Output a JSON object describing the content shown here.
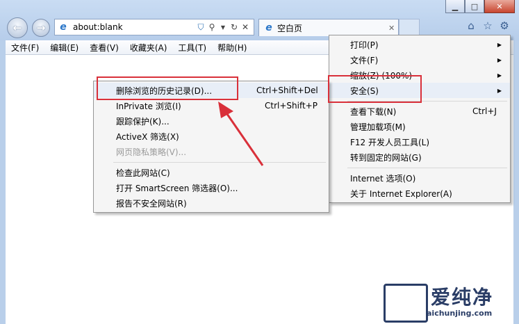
{
  "window": {
    "minimize_glyph": "▁",
    "maximize_glyph": "□",
    "close_glyph": "✕"
  },
  "address_bar": {
    "url": "about:blank"
  },
  "tab": {
    "title": "空白页",
    "close_glyph": "✕"
  },
  "menubar": {
    "items": [
      "文件(F)",
      "编辑(E)",
      "查看(V)",
      "收藏夹(A)",
      "工具(T)",
      "帮助(H)"
    ]
  },
  "tools_menu": {
    "items": [
      {
        "label": "打印(P)",
        "submenu": true
      },
      {
        "label": "文件(F)",
        "submenu": true
      },
      {
        "label": "缩放(Z) (100%)",
        "submenu": true
      },
      {
        "label": "安全(S)",
        "submenu": true
      },
      {
        "label": "查看下载(N)",
        "shortcut": "Ctrl+J"
      },
      {
        "label": "管理加载项(M)"
      },
      {
        "label": "F12 开发人员工具(L)"
      },
      {
        "label": "转到固定的网站(G)"
      },
      {
        "label": "Internet 选项(O)"
      },
      {
        "label": "关于 Internet Explorer(A)"
      }
    ]
  },
  "safety_menu": {
    "items": [
      {
        "label": "删除浏览的历史记录(D)...",
        "shortcut": "Ctrl+Shift+Del"
      },
      {
        "label": "InPrivate 浏览(I)",
        "shortcut": "Ctrl+Shift+P"
      },
      {
        "label": "跟踪保护(K)..."
      },
      {
        "label": "ActiveX 筛选(X)"
      },
      {
        "label": "网页隐私策略(V)...",
        "disabled": true
      },
      {
        "label": "检查此网站(C)"
      },
      {
        "label": "打开 SmartScreen 筛选器(O)..."
      },
      {
        "label": "报告不安全网站(R)"
      }
    ]
  },
  "annotation": {
    "highlight_color": "#d9303a"
  },
  "watermark": {
    "brand": "爱纯净",
    "site": "aichunjing.com"
  }
}
